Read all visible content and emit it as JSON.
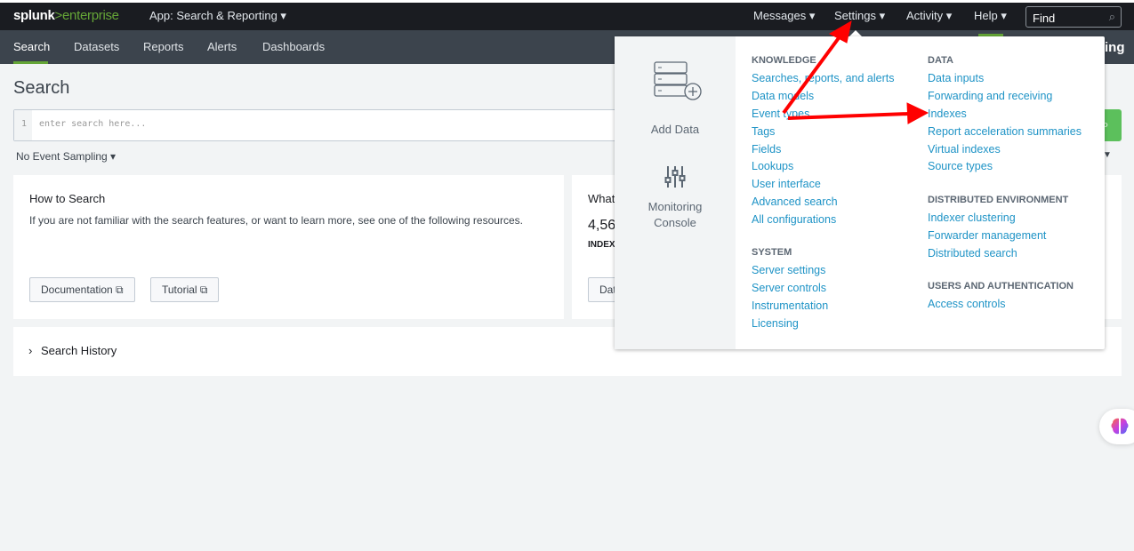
{
  "topbar": {
    "logo_brand": "splunk",
    "logo_sep": ">",
    "logo_product": "enterprise",
    "app_selector": "App: Search & Reporting ▾",
    "menus": [
      {
        "label": "Messages ▾"
      },
      {
        "label": "Settings ▾"
      },
      {
        "label": "Activity ▾"
      },
      {
        "label": "Help ▾"
      }
    ],
    "find_placeholder": "Find"
  },
  "nav": {
    "items": [
      {
        "label": "Search",
        "active": true
      },
      {
        "label": "Datasets"
      },
      {
        "label": "Reports"
      },
      {
        "label": "Alerts"
      },
      {
        "label": "Dashboards"
      }
    ],
    "right_partial": "ing"
  },
  "page": {
    "title": "Search",
    "search": {
      "line_number": "1",
      "placeholder": "enter search here..."
    },
    "sampling": "No Event Sampling ▾"
  },
  "how_to": {
    "title": "How to Search",
    "text": "If you are not familiar with the search features, or want to learn more, see one of the following resources.",
    "buttons": [
      "Documentation ⧉",
      "Tutorial ⧉"
    ]
  },
  "whats_card": {
    "title": "What",
    "count": "4,56",
    "label": "INDEX",
    "button": "Dat"
  },
  "history": {
    "label": "Search History"
  },
  "settings_menu": {
    "tiles": [
      {
        "label": "Add Data",
        "icon": "add-data-icon"
      },
      {
        "label": "Monitoring Console",
        "icon": "sliders-icon"
      }
    ],
    "knowledge": {
      "title": "KNOWLEDGE",
      "items": [
        "Searches, reports, and alerts",
        "Data models",
        "Event types",
        "Tags",
        "Fields",
        "Lookups",
        "User interface",
        "Advanced search",
        "All configurations"
      ]
    },
    "system": {
      "title": "SYSTEM",
      "items": [
        "Server settings",
        "Server controls",
        "Instrumentation",
        "Licensing"
      ]
    },
    "data": {
      "title": "DATA",
      "items": [
        "Data inputs",
        "Forwarding and receiving",
        "Indexes",
        "Report acceleration summaries",
        "Virtual indexes",
        "Source types"
      ]
    },
    "distributed": {
      "title": "DISTRIBUTED ENVIRONMENT",
      "items": [
        "Indexer clustering",
        "Forwarder management",
        "Distributed search"
      ]
    },
    "users": {
      "title": "USERS AND AUTHENTICATION",
      "items": [
        "Access controls"
      ]
    }
  },
  "colors": {
    "accent_green": "#65a637",
    "link": "#1e93c6",
    "topbar": "#1a1c21",
    "navbar": "#3c444d",
    "annotation_arrow": "#ff0000"
  }
}
